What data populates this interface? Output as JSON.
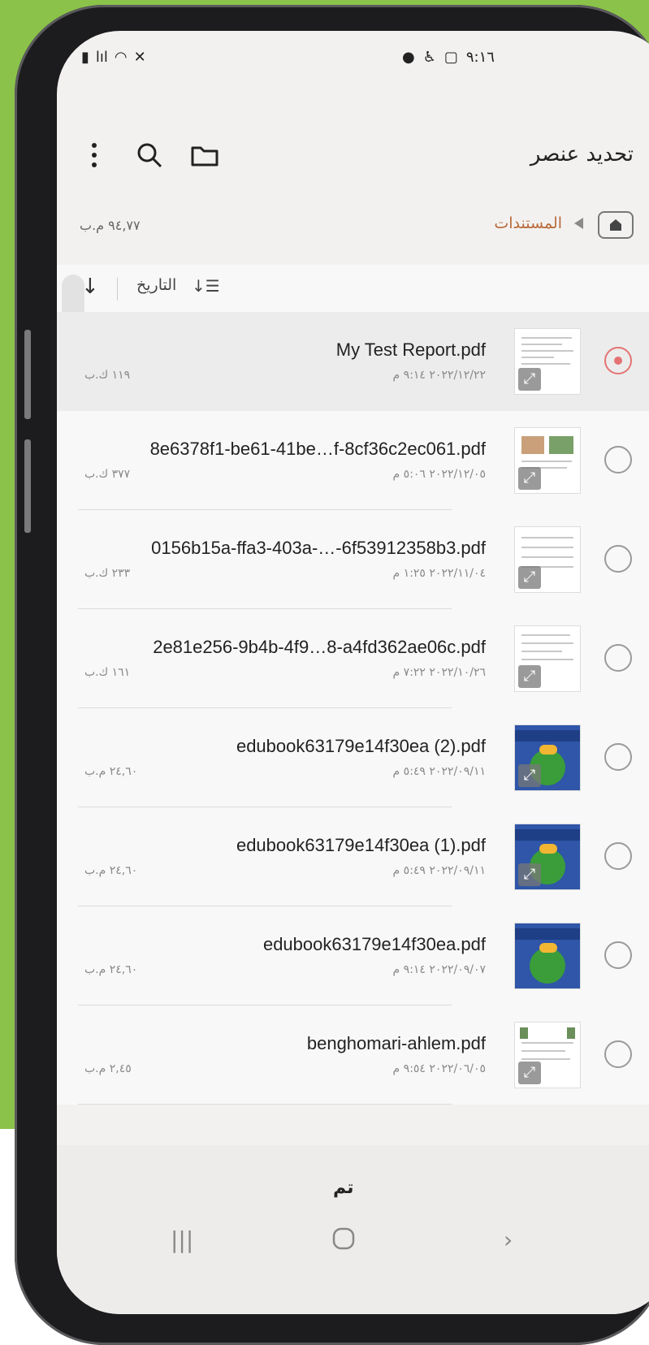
{
  "status": {
    "time": "٩:١٦",
    "left_icons": [
      "battery-icon",
      "signal-icon",
      "wifi-icon",
      "mute-icon"
    ],
    "right_icons": [
      "phone-icon",
      "accessibility-icon",
      "screenshot-icon"
    ]
  },
  "appbar": {
    "title": "تحديد عنصر",
    "actions": [
      "more-icon",
      "search-icon",
      "folder-icon"
    ]
  },
  "breadcrumb": {
    "current": "المستندات",
    "storage": "٩٤,٧٧ م.ب"
  },
  "sort": {
    "label": "التاريخ",
    "direction": "↓"
  },
  "files": [
    {
      "name": "My Test Report.pdf",
      "date": "٢٠٢٢/١٢/٢٢ ٩:١٤ م",
      "size": "١١٩ ك.ب",
      "selected": true
    },
    {
      "name": "8e6378f1-be61-41be…f-8cf36c2ec061.pdf",
      "date": "٢٠٢٢/١٢/٠٥ ٥:٠٦ م",
      "size": "٣٧٧ ك.ب",
      "selected": false
    },
    {
      "name": "0156b15a-ffa3-403a-…-6f53912358b3.pdf",
      "date": "٢٠٢٢/١١/٠٤ ١:٢٥ م",
      "size": "٢٣٣ ك.ب",
      "selected": false
    },
    {
      "name": "2e81e256-9b4b-4f9…8-a4fd362ae06c.pdf",
      "date": "٢٠٢٢/١٠/٢٦ ٧:٢٢ م",
      "size": "١٦١ ك.ب",
      "selected": false
    },
    {
      "name": "edubook63179e14f30ea (2).pdf",
      "date": "٢٠٢٢/٠٩/١١ ٥:٤٩ م",
      "size": "٢٤,٦٠ م.ب",
      "selected": false
    },
    {
      "name": "edubook63179e14f30ea (1).pdf",
      "date": "٢٠٢٢/٠٩/١١ ٥:٤٩ م",
      "size": "٢٤,٦٠ م.ب",
      "selected": false
    },
    {
      "name": "edubook63179e14f30ea.pdf",
      "date": "٢٠٢٢/٠٩/٠٧ ٩:١٤ م",
      "size": "٢٤,٦٠ م.ب",
      "selected": false
    },
    {
      "name": "benghomari-ahlem.pdf",
      "date": "٢٠٢٢/٠٦/٠٥ ٩:٥٤ م",
      "size": "٢,٤٥ م.ب",
      "selected": false
    }
  ],
  "bottom": {
    "done_label": "تم",
    "nav": {
      "recents": "|||",
      "back": "›"
    }
  },
  "colors": {
    "accent": "#e57373",
    "breadcrumb": "#b86a3a",
    "background": "#8bc34a"
  }
}
